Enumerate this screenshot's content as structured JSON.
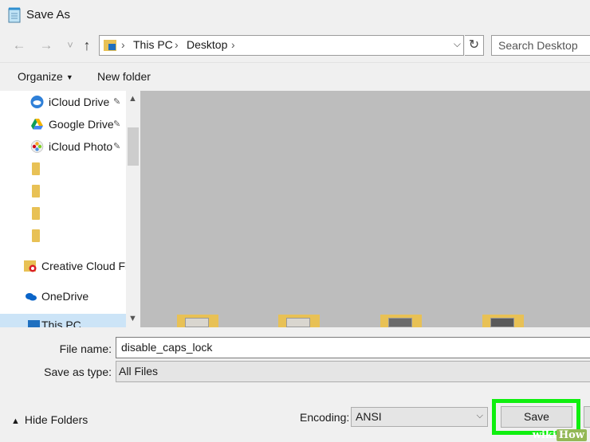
{
  "window": {
    "title": "Save As",
    "title_icon": "notepad-icon"
  },
  "nav": {
    "back_icon": "←",
    "forward_icon": "→",
    "recent_icon": "˅",
    "up_icon": "↑",
    "breadcrumb": [
      "This PC",
      "Desktop"
    ],
    "separator": "›",
    "refresh_icon": "↻",
    "dropdown_icon": "⌵",
    "search_placeholder": "Search Desktop"
  },
  "commands": {
    "organize": "Organize",
    "new_folder": "New folder"
  },
  "sidebar": {
    "items": [
      {
        "label": "iCloud Drive",
        "icon": "icloud-icon",
        "pinned": true
      },
      {
        "label": "Google Drive",
        "icon": "google-drive-icon",
        "pinned": true
      },
      {
        "label": "iCloud Photo",
        "icon": "icloud-photos-icon",
        "pinned": true
      },
      {
        "label": "",
        "icon": "folder-icon"
      },
      {
        "label": "",
        "icon": "folder-icon"
      },
      {
        "label": "",
        "icon": "folder-icon"
      },
      {
        "label": "",
        "icon": "folder-icon"
      },
      {
        "label": "Creative Cloud Fil",
        "icon": "creative-cloud-icon"
      },
      {
        "label": "OneDrive",
        "icon": "onedrive-icon"
      },
      {
        "label": "This PC",
        "icon": "this-pc-icon",
        "selected": true
      }
    ],
    "pin_glyph": "📌"
  },
  "form": {
    "filename_label": "File name:",
    "filename_value": "disable_caps_lock",
    "savetype_label": "Save as type:",
    "savetype_value": "All Files",
    "hide_folders": "Hide Folders",
    "encoding_label": "Encoding:",
    "encoding_value": "ANSI",
    "save_label": "Save"
  },
  "watermark": {
    "prefix": "wiki",
    "suffix": "How"
  },
  "colors": {
    "highlight": "#0fef0f",
    "content_bg": "#bdbdbd",
    "folder": "#e8c155"
  }
}
